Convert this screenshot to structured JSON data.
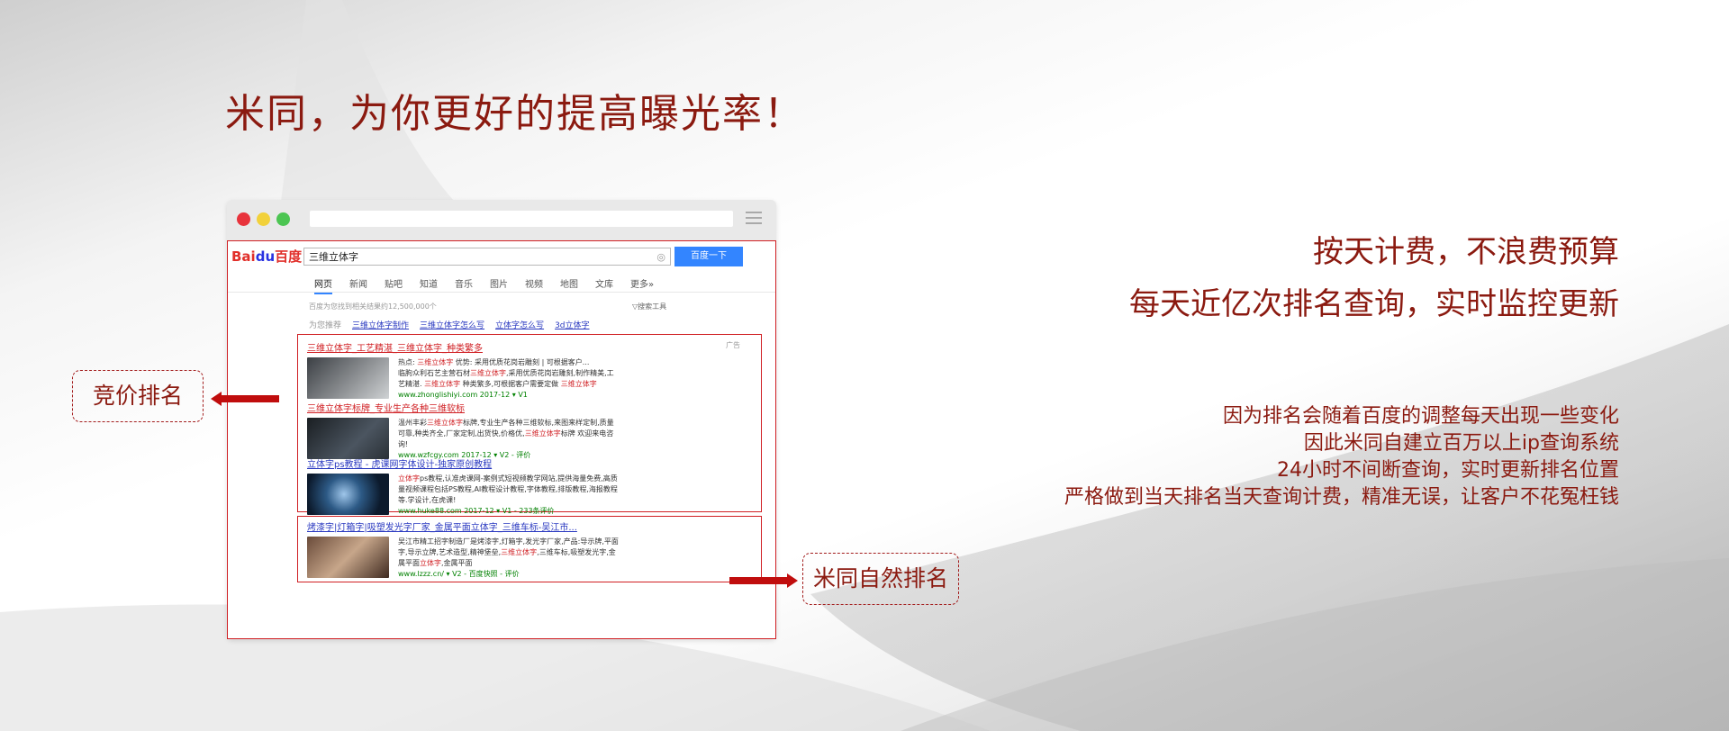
{
  "headline": "米同，为你更好的提高曝光率！",
  "browser": {
    "logo_part1": "Bai",
    "logo_paw": "du",
    "logo_part2": "百度",
    "search_query": "三维立体字",
    "search_button": "百度一下",
    "tabs": [
      "网页",
      "新闻",
      "贴吧",
      "知道",
      "音乐",
      "图片",
      "视频",
      "地图",
      "文库",
      "更多»"
    ],
    "result_info": "百度为您找到相关结果约12,500,000个",
    "search_tools": "▽搜索工具",
    "recommend_label": "为您推荐",
    "recommend_links": [
      "三维立体字制作",
      "三维立体字怎么写",
      "立体字怎么写",
      "3d立体字"
    ],
    "ad_label": "广告",
    "results": [
      {
        "title": "三维立体字_工艺精湛_三维立体字_种类繁多",
        "line1": "热点: 三维立体字    优势: 采用优质花岗岩雕刻 | 可根据客户...",
        "line2": "临朐众利石艺主营石材三维立体字,采用优质花岗岩雕刻,制作精美,工",
        "line3": "艺精湛. 三维立体字 种类繁多,可根据客户需要定做 三维立体字",
        "url": "www.zhonglishiyi.com  2017-12  ▾  V1"
      },
      {
        "title": "三维立体字标牌_专业生产各种三维软标",
        "line1": "温州丰彩三维立体字标牌,专业生产各种三维软标,来图来样定制,质量",
        "line2": "可靠,种类齐全,厂家定制,出货快,价格优,三维立体字标牌 欢迎来电咨",
        "line3": "询!",
        "url": "www.wzfcgy.com  2017-12  ▾  V2 - 评价"
      },
      {
        "title": "立体字ps教程 - 虎课网字体设计-独家原创教程",
        "line1": "立体字ps教程,认准虎课网-案例式短视频教学网站,提供海量免费,高质",
        "line2": "量视频课程包括PS教程,AI教程设计教程,字体教程,排版教程,海报教程",
        "line3": "等.学设计,在虎课!",
        "url": "www.huke88.com  2017-12  ▾  V1 - 233条评价"
      },
      {
        "title": "烤漆字|灯箱字|吸塑发光字厂家_金属平面立体字_三维车标-吴江市...",
        "line1": "吴江市精工招字制造厂是烤漆字,灯箱字,发光字厂家,产品:导示牌,平面",
        "line2": "字,导示立牌,艺术造型,精神堡垒,三维立体字,三维车标,吸塑发光字,金",
        "line3": "属平面立体字,金属平面",
        "url": "www.lzzz.cn/  ▾  V2 - 百度快照 - 评价"
      }
    ]
  },
  "callouts": {
    "left": "竞价排名",
    "right": "米同自然排名"
  },
  "right_text": {
    "line1": "按天计费，不浪费预算",
    "line2": "每天近亿次排名查询，实时监控更新",
    "small1": "因为排名会随着百度的调整每天出现一些变化",
    "small2": "因此米同自建立百万以上ip查询系统",
    "small3": "24小时不间断查询，实时更新排名位置",
    "small4": "严格做到当天排名当天查询计费，精准无误，让客户不花冤枉钱"
  },
  "colors": {
    "accent": "#8b1a10",
    "highlight_red": "#d01f23",
    "baidu_blue": "#3385ff",
    "link_blue": "#2a39c0"
  }
}
